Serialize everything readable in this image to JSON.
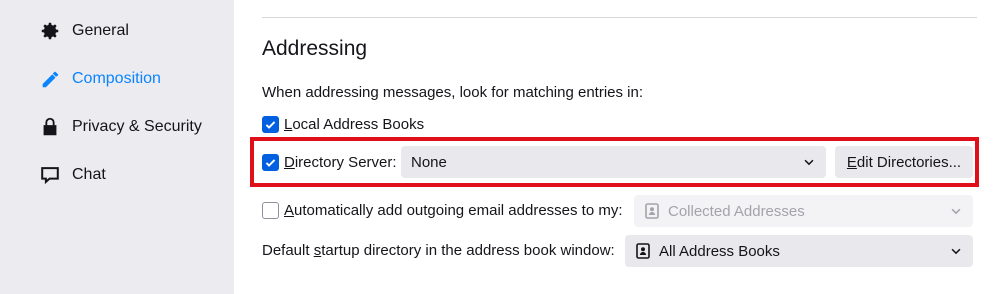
{
  "sidebar": {
    "items": [
      {
        "label": "General",
        "icon": "gear-icon"
      },
      {
        "label": "Composition",
        "icon": "pencil-icon",
        "active": true
      },
      {
        "label": "Privacy & Security",
        "icon": "lock-icon"
      },
      {
        "label": "Chat",
        "icon": "chat-bubble-icon"
      }
    ]
  },
  "addressing": {
    "heading": "Addressing",
    "description": "When addressing messages, look for matching entries in:",
    "local_books": {
      "label_ul": "L",
      "label_rest": "ocal Address Books",
      "checked": true
    },
    "directory_server": {
      "label_ul": "D",
      "label_rest": "irectory Server:",
      "checked": true,
      "selected": "None",
      "edit_ul": "E",
      "edit_rest": "dit Directories..."
    },
    "auto_add": {
      "label_ul": "A",
      "label_rest": "utomatically add outgoing email addresses to my:",
      "checked": false,
      "selected": "Collected Addresses"
    },
    "startup_dir": {
      "label_pre": "Default ",
      "label_ul": "s",
      "label_rest": "tartup directory in the address book window:",
      "selected": "All Address Books"
    }
  },
  "colors": {
    "accent": "#0a84ff",
    "checkbox": "#0060df",
    "highlight": "#e0101a",
    "sidebar_bg": "#ececf0"
  }
}
